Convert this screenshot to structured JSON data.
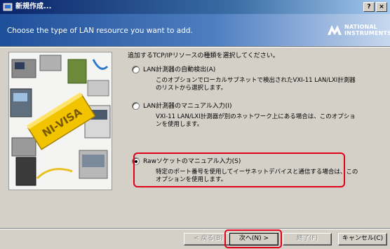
{
  "window": {
    "title": "新規作成...",
    "help_label": "?",
    "close_label": "×"
  },
  "banner": {
    "heading": "Choose the type of LAN resource you want to add.",
    "logo_line1": "NATIONAL",
    "logo_line2": "INSTRUMENTS"
  },
  "illustration": {
    "label": "NI-VISA"
  },
  "content": {
    "prompt": "追加するTCP/IPリソースの種類を選択してください。",
    "options": [
      {
        "label": "LAN計測器の自動検出(A)",
        "description": "このオプションでローカルサブネットで検出されたVXI-11 LAN/LXI計測器のリストから選択します。",
        "selected": false
      },
      {
        "label": "LAN計測器のマニュアル入力(I)",
        "description": "VXI-11 LAN/LXI計測器が別のネットワーク上にある場合は、このオプションを使用します。",
        "selected": false
      },
      {
        "label": "Rawソケットのマニュアル入力(S)",
        "description": "特定のポート番号を使用してイーサネットデバイスと通信する場合は、このオプションを使用します。",
        "selected": true
      }
    ]
  },
  "buttons": {
    "back": "< 戻る(B)",
    "next": "次へ(N) >",
    "finish": "終了(F)",
    "cancel": "キャンセル(C)"
  },
  "colors": {
    "highlight": "#e0001a",
    "title_bar": "#0a246a",
    "banner": "#1e4f99"
  }
}
